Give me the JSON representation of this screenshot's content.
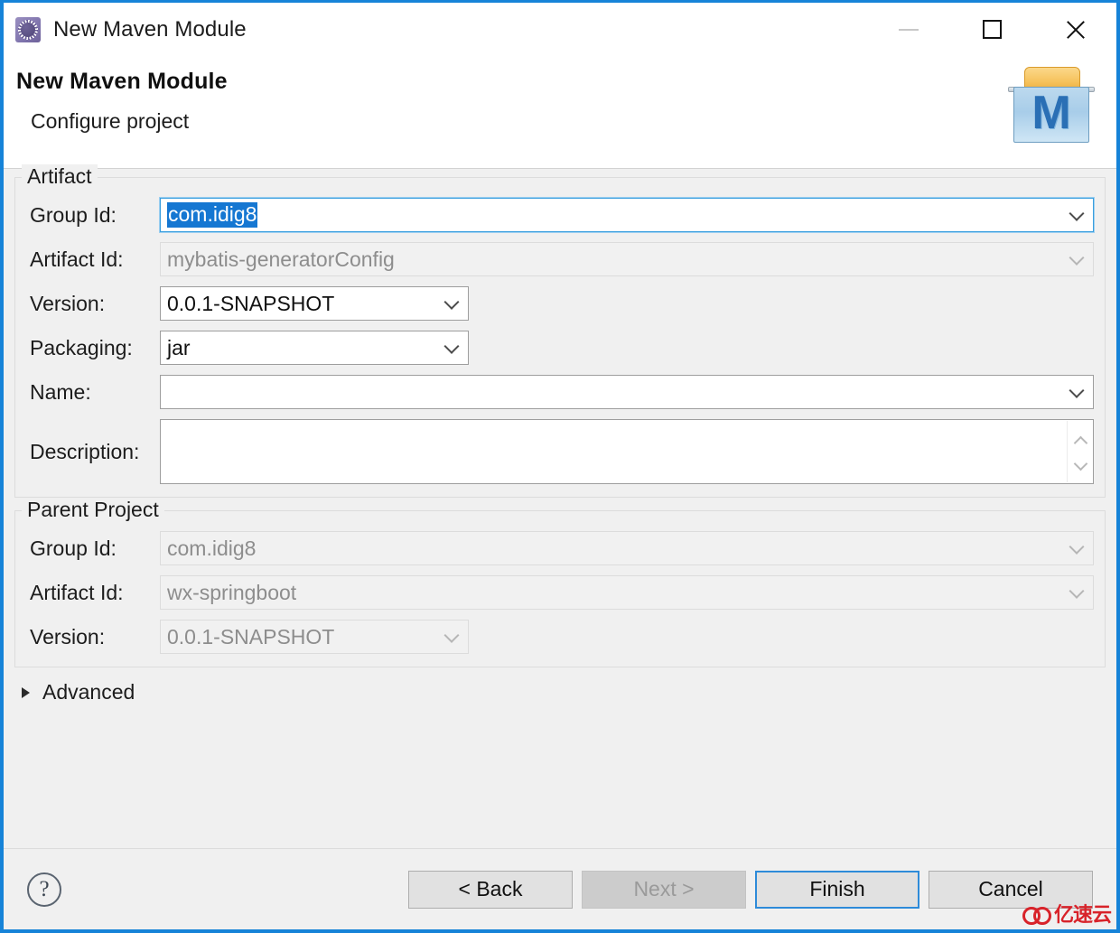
{
  "window": {
    "title": "New Maven Module",
    "icon": "maven-module-icon",
    "controls": {
      "minimize": "minimize-icon",
      "maximize": "maximize-icon",
      "close": "close-icon"
    }
  },
  "header": {
    "title": "New Maven Module",
    "subtitle": "Configure project",
    "logo_letter": "M"
  },
  "artifact": {
    "legend": "Artifact",
    "fields": [
      {
        "label": "Group Id:",
        "value": "com.idig8",
        "state": "focused-selected",
        "has_dropdown": true
      },
      {
        "label": "Artifact Id:",
        "value": "mybatis-generatorConfig",
        "state": "disabled",
        "has_dropdown": true
      },
      {
        "label": "Version:",
        "value": "0.0.1-SNAPSHOT",
        "state": "normal",
        "has_dropdown": true
      },
      {
        "label": "Packaging:",
        "value": "jar",
        "state": "normal",
        "has_dropdown": true
      },
      {
        "label": "Name:",
        "value": "",
        "state": "normal",
        "has_dropdown": true
      },
      {
        "label": "Description:",
        "value": "",
        "state": "normal",
        "has_dropdown": false
      }
    ]
  },
  "parent_project": {
    "legend": "Parent Project",
    "fields": [
      {
        "label": "Group Id:",
        "value": "com.idig8",
        "state": "disabled",
        "has_dropdown": true
      },
      {
        "label": "Artifact Id:",
        "value": "wx-springboot",
        "state": "disabled",
        "has_dropdown": true
      },
      {
        "label": "Version:",
        "value": "0.0.1-SNAPSHOT",
        "state": "disabled",
        "has_dropdown": true
      }
    ]
  },
  "advanced": {
    "label": "Advanced",
    "expanded": false,
    "icon": "triangle-right-icon"
  },
  "footer": {
    "help_icon": "help-question-icon",
    "buttons": [
      {
        "label": "< Back",
        "state": "normal"
      },
      {
        "label": "Next >",
        "state": "disabled"
      },
      {
        "label": "Finish",
        "state": "default"
      },
      {
        "label": "Cancel",
        "state": "normal"
      }
    ]
  },
  "watermark": {
    "text": "亿速云",
    "logo": "cloud-logo-icon"
  },
  "colors": {
    "window_border": "#1683d8",
    "accent_focus": "#3a9ede",
    "selection": "#1577d2",
    "background": "#f0f0f0",
    "disabled_text": "#8d8d8d",
    "watermark": "#d8232a"
  }
}
